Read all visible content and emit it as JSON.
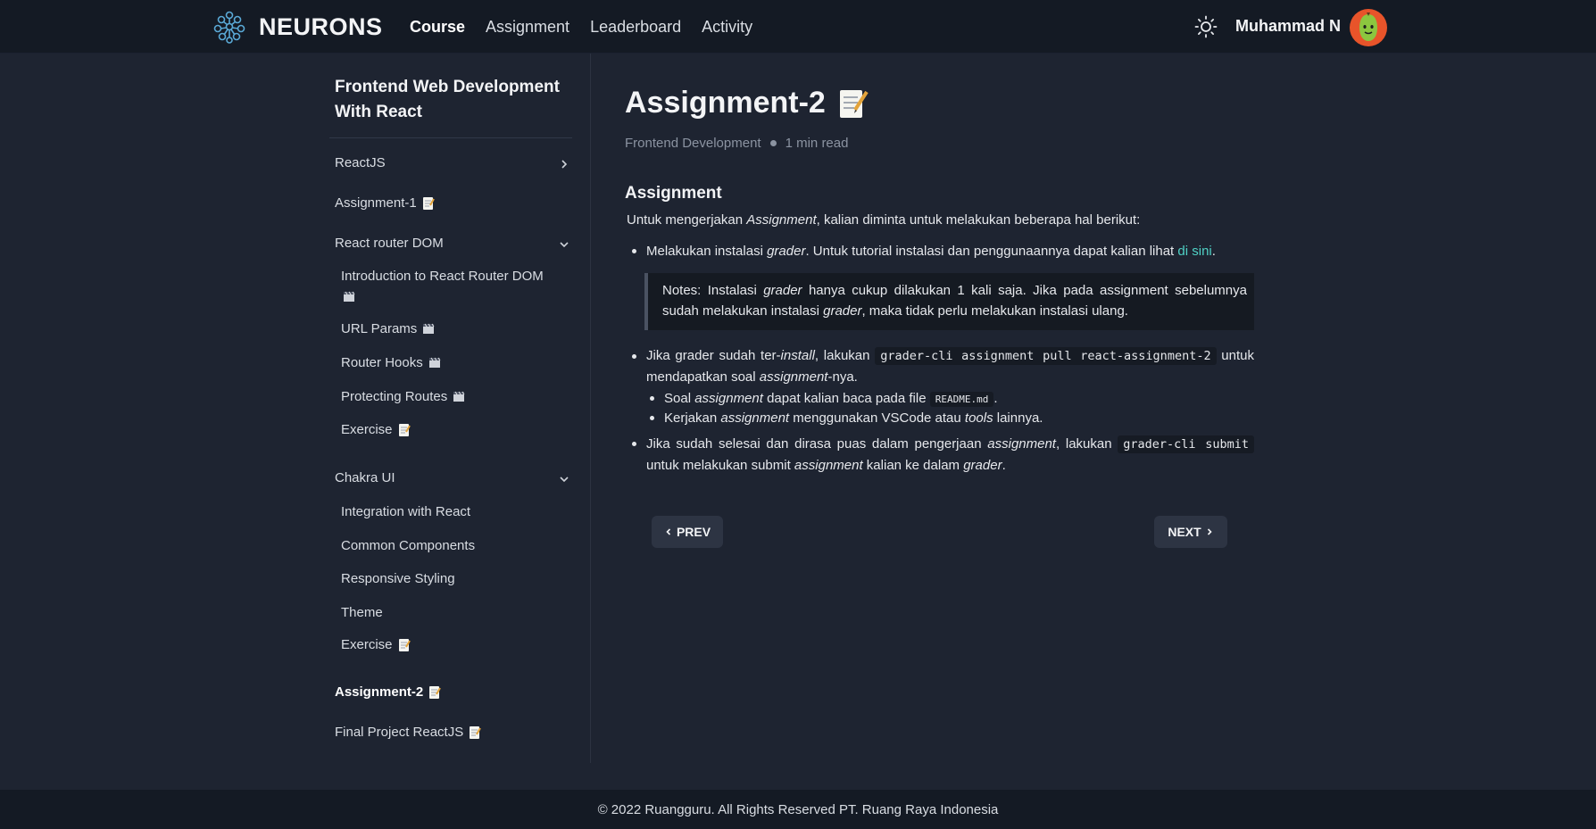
{
  "header": {
    "brand": "NEURONS",
    "nav": [
      "Course",
      "Assignment",
      "Leaderboard",
      "Activity"
    ],
    "active_nav": "Course",
    "user_name": "Muhammad N"
  },
  "sidebar": {
    "course_title": "Frontend Web Development With React",
    "items": [
      {
        "label": "ReactJS",
        "kind": "section",
        "expanded": false
      },
      {
        "label": "Assignment-1",
        "kind": "assignment",
        "icon": "memo-icon"
      },
      {
        "label": "React router DOM",
        "kind": "section",
        "expanded": true
      },
      {
        "label": "Introduction to React Router DOM",
        "kind": "lesson",
        "icon": "clapper-icon"
      },
      {
        "label": "URL Params",
        "kind": "lesson",
        "icon": "clapper-icon"
      },
      {
        "label": "Router Hooks",
        "kind": "lesson",
        "icon": "clapper-icon"
      },
      {
        "label": "Protecting Routes",
        "kind": "lesson",
        "icon": "clapper-icon"
      },
      {
        "label": "Exercise",
        "kind": "exercise",
        "icon": "memo-icon"
      },
      {
        "label": "Chakra UI",
        "kind": "section",
        "expanded": true
      },
      {
        "label": "Integration with React",
        "kind": "lesson"
      },
      {
        "label": "Common Components",
        "kind": "lesson"
      },
      {
        "label": "Responsive Styling",
        "kind": "lesson"
      },
      {
        "label": "Theme",
        "kind": "lesson"
      },
      {
        "label": "Exercise",
        "kind": "exercise",
        "icon": "memo-icon"
      },
      {
        "label": "Assignment-2",
        "kind": "assignment",
        "icon": "memo-icon",
        "current": true
      },
      {
        "label": "Final Project ReactJS",
        "kind": "assignment",
        "icon": "memo-icon"
      }
    ]
  },
  "main": {
    "title": "Assignment-2",
    "category": "Frontend Development",
    "read_time": "1 min read",
    "section_heading": "Assignment",
    "intro_pre": "Untuk mengerjakan ",
    "intro_em": "Assignment",
    "intro_post": ", kalian diminta untuk melakukan beberapa hal berikut:",
    "b1_pre": "Melakukan instalasi ",
    "b1_em": "grader",
    "b1_post": ". Untuk tutorial instalasi dan penggunaannya dapat kalian lihat ",
    "b1_link": "di sini",
    "b1_end": ".",
    "note_pre": "Notes: Instalasi ",
    "note_em1": "grader",
    "note_mid": " hanya cukup dilakukan 1 kali saja. Jika pada assignment sebelumnya sudah melakukan instalasi ",
    "note_em2": "grader",
    "note_post": ", maka tidak perlu melakukan instalasi ulang.",
    "b2_pre": "Jika grader sudah ter-",
    "b2_em": "install",
    "b2_mid": ", lakukan ",
    "b2_code": "grader-cli assignment pull react-assignment-2",
    "b2_post": " untuk mendapatkan soal ",
    "b2_em2": "assignment",
    "b2_end": "-nya.",
    "s1_pre": "Soal ",
    "s1_em": "assignment",
    "s1_mid": " dapat kalian baca pada file ",
    "s1_code": "README.md",
    "s1_end": ".",
    "s2_pre": "Kerjakan ",
    "s2_em": "assignment",
    "s2_mid": " menggunakan VSCode atau ",
    "s2_em2": "tools",
    "s2_end": " lainnya.",
    "b3_pre": "Jika sudah selesai dan dirasa puas dalam pengerjaan ",
    "b3_em": "assignment",
    "b3_mid": ", lakukan ",
    "b3_code": "grader-cli submit",
    "b3_post": " untuk melakukan submit ",
    "b3_em2": "assignment",
    "b3_mid2": " kalian ke dalam ",
    "b3_em3": "grader",
    "b3_end": ".",
    "prev_label": "PREV",
    "next_label": "NEXT"
  },
  "footer": {
    "text": "© 2022 Ruangguru. All Rights Reserved PT. Ruang Raya Indonesia"
  },
  "colors": {
    "background": "#1e2431",
    "topbar": "#141a24",
    "link": "#4fd1c5",
    "avatar": "#e8542a"
  }
}
